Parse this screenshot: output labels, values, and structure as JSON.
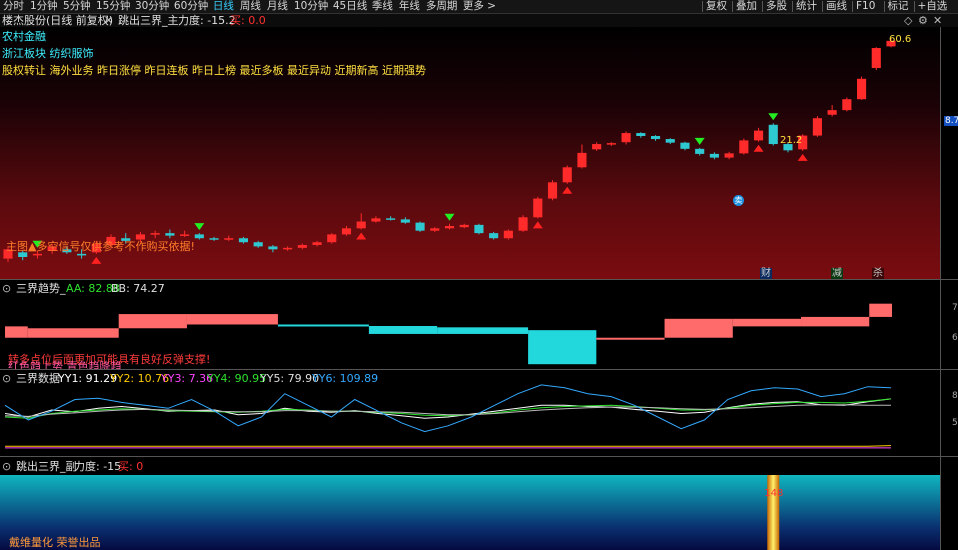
{
  "toolbar": {
    "periods": [
      "分时",
      "1分钟",
      "5分钟",
      "15分钟",
      "30分钟",
      "60分钟",
      "日线",
      "周线",
      "月线",
      "10分钟",
      "45日线",
      "季线",
      "年线",
      "多周期",
      "更多 >"
    ],
    "active_period": "日线",
    "actions": [
      "复权",
      "叠加",
      "多股",
      "统计",
      "画线",
      "F10",
      "标记",
      "+自选"
    ]
  },
  "title_row": {
    "stock": "楼杰股份(日线 前复权)",
    "window_close_icon": "close-icon",
    "indicator_name": "跳出三界_主",
    "force_label": "力度: -15.2",
    "sell_label": "买: 0.0",
    "right_icons": [
      "diamond-icon",
      "gear-icon",
      "close-icon"
    ]
  },
  "concepts": {
    "line1": "农村金融",
    "line2": "浙江板块  纺织服饰",
    "line3": "股权转让 海外业务 昨日涨停 昨日连板 昨日上榜 最近多板 最近异动 近期新高 近期强势"
  },
  "main_chart": {
    "note": "主图▲多空信号仅供参考不作购买依据!",
    "high_label": "60.6",
    "mid_label": "21.2",
    "price_tag": "8.74",
    "callouts": [
      {
        "text": "财",
        "color": "#3aa0ff"
      },
      {
        "text": "减",
        "color": "#2ed04a"
      },
      {
        "text": "杀",
        "color": "#ff4040"
      }
    ],
    "circle_text": "卖",
    "chart_data": {
      "type": "candlestick",
      "series": [
        {
          "o": 5.6,
          "c": 6.2,
          "h": 6.4,
          "l": 5.4
        },
        {
          "o": 6.0,
          "c": 5.7,
          "h": 6.1,
          "l": 5.5
        },
        {
          "o": 5.8,
          "c": 5.9,
          "h": 6.1,
          "l": 5.6
        },
        {
          "o": 6.1,
          "c": 6.4,
          "h": 6.6,
          "l": 5.9
        },
        {
          "o": 6.2,
          "c": 6.0,
          "h": 6.4,
          "l": 5.9
        },
        {
          "o": 5.9,
          "c": 5.8,
          "h": 6.2,
          "l": 5.6
        },
        {
          "o": 6.0,
          "c": 6.6,
          "h": 6.8,
          "l": 5.9
        },
        {
          "o": 6.5,
          "c": 7.1,
          "h": 7.3,
          "l": 6.3
        },
        {
          "o": 7.0,
          "c": 6.8,
          "h": 7.4,
          "l": 6.6
        },
        {
          "o": 6.9,
          "c": 7.3,
          "h": 7.5,
          "l": 6.7
        },
        {
          "o": 7.3,
          "c": 7.4,
          "h": 7.6,
          "l": 7.0
        },
        {
          "o": 7.4,
          "c": 7.2,
          "h": 7.7,
          "l": 7.0
        },
        {
          "o": 7.2,
          "c": 7.3,
          "h": 7.6,
          "l": 7.1
        },
        {
          "o": 7.3,
          "c": 7.0,
          "h": 7.4,
          "l": 6.9
        },
        {
          "o": 7.0,
          "c": 6.9,
          "h": 7.1,
          "l": 6.8
        },
        {
          "o": 6.9,
          "c": 7.0,
          "h": 7.2,
          "l": 6.8
        },
        {
          "o": 7.0,
          "c": 6.7,
          "h": 7.1,
          "l": 6.6
        },
        {
          "o": 6.7,
          "c": 6.4,
          "h": 6.8,
          "l": 6.3
        },
        {
          "o": 6.4,
          "c": 6.2,
          "h": 6.5,
          "l": 6.0
        },
        {
          "o": 6.2,
          "c": 6.3,
          "h": 6.4,
          "l": 6.1
        },
        {
          "o": 6.3,
          "c": 6.5,
          "h": 6.6,
          "l": 6.2
        },
        {
          "o": 6.5,
          "c": 6.7,
          "h": 6.8,
          "l": 6.4
        },
        {
          "o": 6.7,
          "c": 7.3,
          "h": 7.4,
          "l": 6.6
        },
        {
          "o": 7.3,
          "c": 7.8,
          "h": 8.0,
          "l": 7.2
        },
        {
          "o": 7.8,
          "c": 8.4,
          "h": 9.2,
          "l": 7.7
        },
        {
          "o": 8.4,
          "c": 8.7,
          "h": 8.9,
          "l": 8.3
        },
        {
          "o": 8.7,
          "c": 8.6,
          "h": 8.9,
          "l": 8.5
        },
        {
          "o": 8.6,
          "c": 8.3,
          "h": 8.8,
          "l": 8.2
        },
        {
          "o": 8.3,
          "c": 7.6,
          "h": 8.4,
          "l": 7.5
        },
        {
          "o": 7.6,
          "c": 7.8,
          "h": 7.9,
          "l": 7.5
        },
        {
          "o": 7.8,
          "c": 8.0,
          "h": 8.2,
          "l": 7.7
        },
        {
          "o": 7.9,
          "c": 8.1,
          "h": 8.2,
          "l": 7.8
        },
        {
          "o": 8.1,
          "c": 7.4,
          "h": 8.2,
          "l": 7.3
        },
        {
          "o": 7.4,
          "c": 7.0,
          "h": 7.5,
          "l": 6.9
        },
        {
          "o": 7.0,
          "c": 7.6,
          "h": 7.7,
          "l": 6.9
        },
        {
          "o": 7.6,
          "c": 8.8,
          "h": 9.0,
          "l": 7.5
        },
        {
          "o": 8.8,
          "c": 10.8,
          "h": 11.0,
          "l": 8.7
        },
        {
          "o": 10.8,
          "c": 12.9,
          "h": 13.2,
          "l": 10.6
        },
        {
          "o": 12.9,
          "c": 15.2,
          "h": 15.5,
          "l": 12.7
        },
        {
          "o": 15.2,
          "c": 17.8,
          "h": 19.5,
          "l": 15.0
        },
        {
          "o": 18.5,
          "c": 19.6,
          "h": 20.0,
          "l": 18.2
        },
        {
          "o": 19.6,
          "c": 19.8,
          "h": 20.0,
          "l": 19.2
        },
        {
          "o": 20.0,
          "c": 22.1,
          "h": 22.5,
          "l": 19.5
        },
        {
          "o": 22.1,
          "c": 21.4,
          "h": 22.3,
          "l": 21.0
        },
        {
          "o": 21.4,
          "c": 20.7,
          "h": 21.6,
          "l": 20.3
        },
        {
          "o": 20.7,
          "c": 19.9,
          "h": 20.9,
          "l": 19.6
        },
        {
          "o": 19.9,
          "c": 18.6,
          "h": 20.1,
          "l": 18.3
        },
        {
          "o": 18.6,
          "c": 17.6,
          "h": 18.8,
          "l": 17.3
        },
        {
          "o": 17.6,
          "c": 16.9,
          "h": 17.9,
          "l": 16.6
        },
        {
          "o": 16.9,
          "c": 17.7,
          "h": 18.0,
          "l": 16.6
        },
        {
          "o": 17.7,
          "c": 20.4,
          "h": 20.8,
          "l": 17.5
        },
        {
          "o": 20.4,
          "c": 22.7,
          "h": 23.4,
          "l": 20.1
        },
        {
          "o": 24.2,
          "c": 19.6,
          "h": 24.6,
          "l": 19.3
        },
        {
          "o": 19.6,
          "c": 18.3,
          "h": 20.0,
          "l": 17.9
        },
        {
          "o": 18.5,
          "c": 21.5,
          "h": 21.8,
          "l": 18.2
        },
        {
          "o": 21.5,
          "c": 26.0,
          "h": 26.6,
          "l": 21.2
        },
        {
          "o": 27.0,
          "c": 28.4,
          "h": 30.0,
          "l": 26.5
        },
        {
          "o": 28.4,
          "c": 32.0,
          "h": 32.6,
          "l": 28.0
        },
        {
          "o": 32.0,
          "c": 40.0,
          "h": 41.0,
          "l": 31.8
        },
        {
          "o": 45.0,
          "c": 56.0,
          "h": 56.5,
          "l": 44.0
        },
        {
          "o": 57.0,
          "c": 60.6,
          "h": 62.0,
          "l": 56.5
        }
      ],
      "ylim": [
        5,
        66
      ],
      "y_scale": "log"
    }
  },
  "trend_pane": {
    "title": "三界趋势_",
    "aa": "AA: 82.88",
    "bb": "BB: 74.27",
    "note1": "转多点位后面更加可能具有良好反弹支撑!",
    "note2": "红色趋上势 青色趋降趋",
    "chart_data": {
      "type": "area",
      "segments": [
        {
          "x0": 0,
          "x1": 1,
          "top": 77.0,
          "bottom": 71.0,
          "color": "#ff6b6b"
        },
        {
          "x0": 1,
          "x1": 5,
          "top": 76.0,
          "bottom": 71.0,
          "color": "#ff6b6b"
        },
        {
          "x0": 5,
          "x1": 8,
          "top": 83.5,
          "bottom": 76.0,
          "color": "#ff6b6b"
        },
        {
          "x0": 8,
          "x1": 12,
          "top": 83.5,
          "bottom": 78.0,
          "color": "#ff6b6b"
        },
        {
          "x0": 12,
          "x1": 16,
          "top": 78.0,
          "bottom": 78.0,
          "color": "#22d8dd"
        },
        {
          "x0": 16,
          "x1": 19,
          "top": 77.2,
          "bottom": 73.0,
          "color": "#22d8dd"
        },
        {
          "x0": 19,
          "x1": 23,
          "top": 76.5,
          "bottom": 73.0,
          "color": "#22d8dd"
        },
        {
          "x0": 23,
          "x1": 26,
          "top": 75.0,
          "bottom": 57.0,
          "color": "#22d8dd"
        },
        {
          "x0": 26,
          "x1": 29,
          "top": 71.0,
          "bottom": 71.0,
          "color": "#ff6b6b"
        },
        {
          "x0": 29,
          "x1": 32,
          "top": 81.0,
          "bottom": 71.0,
          "color": "#ff6b6b"
        },
        {
          "x0": 32,
          "x1": 35,
          "top": 81.0,
          "bottom": 77.0,
          "color": "#ff6b6b"
        },
        {
          "x0": 35,
          "x1": 38,
          "top": 82.0,
          "bottom": 77.0,
          "color": "#ff6b6b"
        },
        {
          "x0": 38,
          "x1": 39,
          "top": 89.0,
          "bottom": 82.0,
          "color": "#ff6b6b"
        }
      ],
      "ylim": [
        55,
        92
      ]
    }
  },
  "data_pane": {
    "title": "三界数据",
    "yy1": "YY1: 91.29",
    "yy2": "YY2: 10.76",
    "yy3": "YY3: 7.36",
    "yy4": "YY4: 90.95",
    "yy5": "YY5: 79.90",
    "yy6": "YY6: 109.89",
    "chart_data": {
      "type": "line",
      "series": [
        {
          "name": "YY1",
          "color": "#ffffff",
          "values": [
            66,
            60,
            72,
            69,
            75,
            78,
            74,
            70,
            71,
            72,
            64,
            66,
            75,
            70,
            68,
            71,
            66,
            62,
            58,
            60,
            65,
            70,
            75,
            80,
            80,
            78,
            77,
            73,
            70,
            66,
            68,
            76,
            82,
            85,
            86,
            81,
            80,
            86,
            91
          ]
        },
        {
          "name": "YY2",
          "color": "#ffcc00",
          "values": [
            10,
            10,
            10,
            10,
            10,
            10,
            10,
            10,
            10,
            10,
            10,
            10,
            10,
            10,
            10,
            10,
            10,
            10,
            10,
            10,
            10,
            10,
            10,
            10,
            10,
            10,
            10,
            10,
            10,
            10,
            10,
            10,
            10,
            10,
            10,
            10,
            10,
            10,
            11
          ]
        },
        {
          "name": "YY3",
          "color": "#ff44ff",
          "values": [
            7,
            7,
            7,
            7,
            7,
            7,
            7,
            7,
            7,
            7,
            7,
            7,
            7,
            7,
            7,
            7,
            7,
            7,
            7,
            7,
            7,
            7,
            7,
            7,
            7,
            7,
            7,
            7,
            7,
            7,
            7,
            7,
            7,
            7,
            7,
            7,
            7,
            7,
            7
          ]
        },
        {
          "name": "YY4",
          "color": "#2ee22e",
          "values": [
            60,
            58,
            66,
            70,
            72,
            74,
            73,
            71,
            70,
            69,
            68,
            70,
            73,
            72,
            70,
            70,
            68,
            66,
            63,
            62,
            64,
            67,
            72,
            76,
            78,
            79,
            80,
            78,
            75,
            72,
            72,
            75,
            80,
            83,
            85,
            85,
            84,
            87,
            91
          ]
        },
        {
          "name": "YY5",
          "color": "#bbbbbb",
          "values": [
            62,
            61,
            65,
            67,
            70,
            72,
            73,
            72,
            71,
            70,
            69,
            69,
            71,
            71,
            70,
            70,
            69,
            68,
            66,
            64,
            64,
            66,
            69,
            72,
            74,
            76,
            77,
            77,
            76,
            74,
            73,
            74,
            76,
            78,
            80,
            81,
            81,
            80,
            80
          ]
        },
        {
          "name": "YY6",
          "color": "#33aaff",
          "values": [
            80,
            55,
            70,
            90,
            92,
            85,
            80,
            75,
            90,
            70,
            45,
            60,
            100,
            80,
            60,
            90,
            70,
            50,
            35,
            45,
            60,
            80,
            100,
            115,
            110,
            100,
            95,
            80,
            60,
            40,
            55,
            90,
            105,
            110,
            108,
            95,
            100,
            112,
            110
          ]
        }
      ],
      "ylim": [
        0,
        120
      ]
    }
  },
  "sub_pane": {
    "title": "跳出三界_副",
    "force_label": "力度: -15",
    "sell_label": "买: 0",
    "spike_label": "148",
    "footer": "戴维量化 荣誉出品",
    "spike_index": 52
  }
}
